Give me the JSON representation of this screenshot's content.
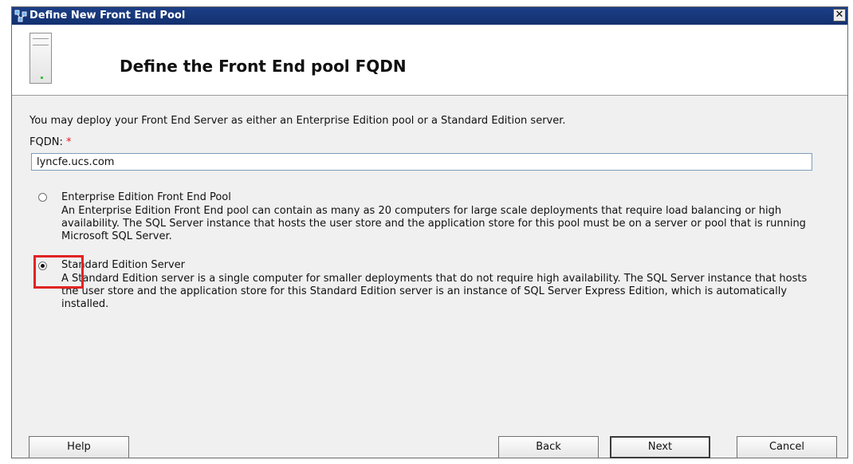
{
  "window": {
    "title": "Define New Front End Pool",
    "close_glyph": "✕"
  },
  "header": {
    "title": "Define the Front End pool FQDN",
    "icon": "server-icon"
  },
  "intro_text": "You may deploy your Front End Server as either an Enterprise Edition pool or a Standard Edition server.",
  "fqdn": {
    "label": "FQDN:",
    "required_marker": "*",
    "value": "lyncfe.ucs.com"
  },
  "options": [
    {
      "label": "Enterprise Edition Front End Pool",
      "selected": false,
      "description": "An Enterprise Edition Front End pool can contain as many as 20 computers for large scale deployments that require load balancing or high availability. The SQL Server instance that hosts the user store and the application store for this pool must be on a server or pool that is running Microsoft SQL Server."
    },
    {
      "label": "Standard Edition Server",
      "selected": true,
      "description": "A Standard Edition server is a single computer for smaller deployments that do not require high availability. The SQL Server instance that hosts the user store and the application store for this Standard Edition server is an instance of SQL Server Express Edition, which is automatically installed."
    }
  ],
  "buttons": {
    "help": "Help",
    "back": "Back",
    "next": "Next",
    "cancel": "Cancel"
  },
  "colors": {
    "titlebar": "#1d3f87",
    "highlight": "#e02424",
    "required": "#e01b1b"
  }
}
